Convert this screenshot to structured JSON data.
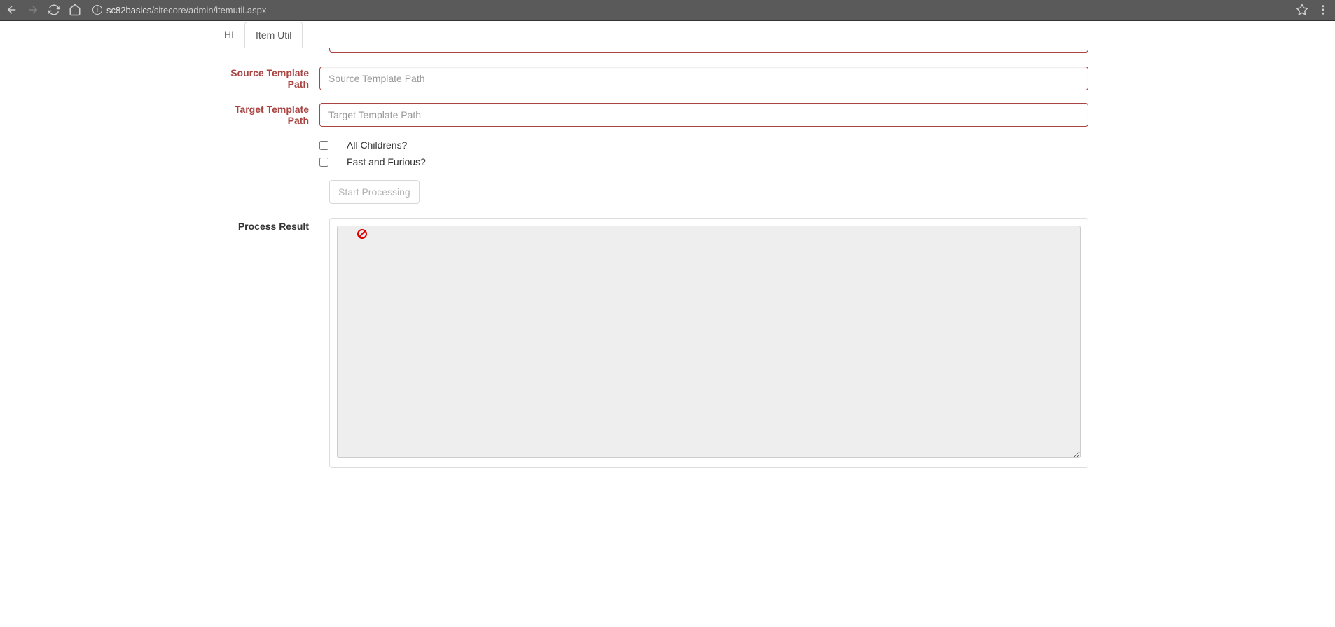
{
  "browser": {
    "url_host": "sc82basics",
    "url_path": "/sitecore/admin/itemutil.aspx"
  },
  "tabs": {
    "tab1": "HI",
    "tab2": "Item Util"
  },
  "form": {
    "source_template_label": "Source Template Path",
    "source_template_placeholder": "Source Template Path",
    "source_template_value": "",
    "target_template_label": "Target Template Path",
    "target_template_placeholder": "Target Template Path",
    "target_template_value": "",
    "checkbox_all_children": "All Childrens?",
    "checkbox_fast_furious": "Fast and Furious?",
    "start_button": "Start Processing",
    "result_label": "Process Result",
    "result_value": ""
  }
}
